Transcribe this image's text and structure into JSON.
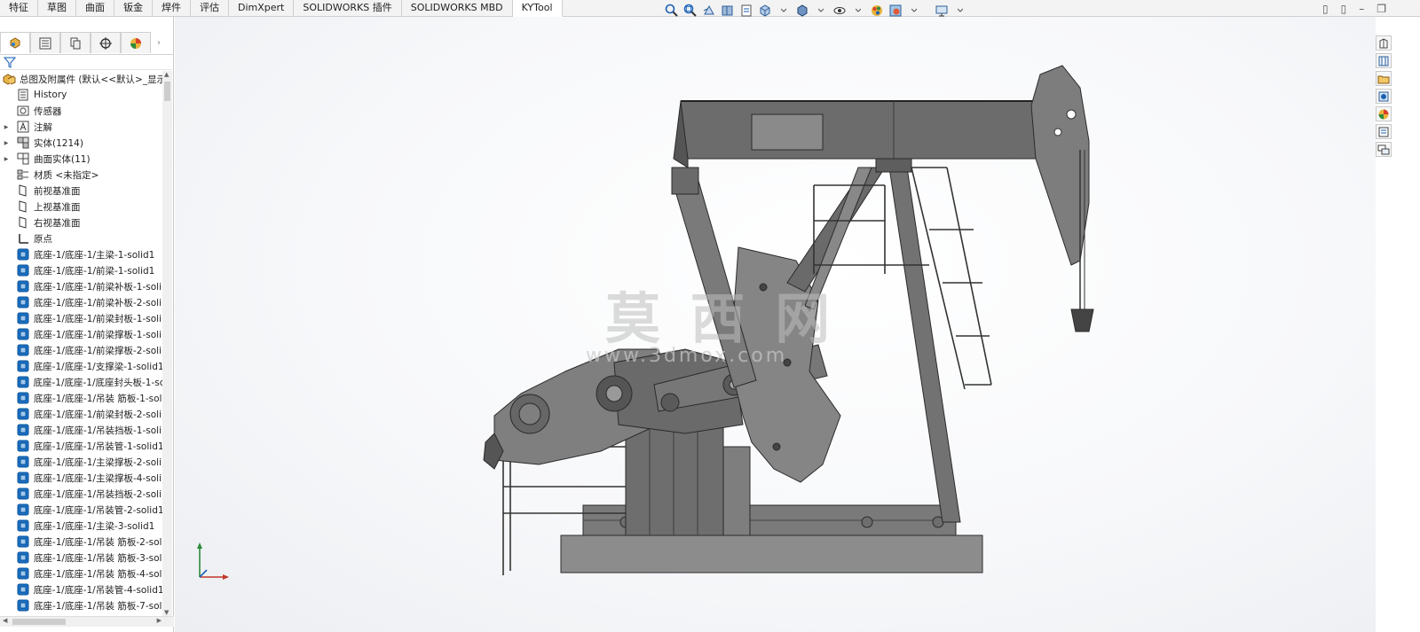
{
  "tabs": [
    {
      "label": "特征",
      "active": false
    },
    {
      "label": "草图",
      "active": false
    },
    {
      "label": "曲面",
      "active": false
    },
    {
      "label": "钣金",
      "active": false
    },
    {
      "label": "焊件",
      "active": false
    },
    {
      "label": "评估",
      "active": false
    },
    {
      "label": "DimXpert",
      "active": false
    },
    {
      "label": "SOLIDWORKS 插件",
      "active": false
    },
    {
      "label": "SOLIDWORKS MBD",
      "active": false
    },
    {
      "label": "KYTool",
      "active": true
    }
  ],
  "hud_icons": [
    "zoom-to-fit-icon",
    "zoom-area-icon",
    "previous-view-icon",
    "section-view-icon",
    "dynamic-annotation-icon",
    "view-orientation-icon",
    "display-style-icon",
    "hide-show-icon",
    "edit-appearance-icon",
    "apply-scene-icon",
    "view-settings-icon"
  ],
  "panel_tabs": [
    "featuremanager-icon",
    "propertymanager-icon",
    "configurationmanager-icon",
    "dimxpert-icon",
    "display-manager-icon"
  ],
  "tree": {
    "root_label": "总图及附属件 (默认<<默认>_显示状",
    "items": [
      {
        "label": "History",
        "icon": "history",
        "expandable": false
      },
      {
        "label": "传感器",
        "icon": "sensor",
        "expandable": false
      },
      {
        "label": "注解",
        "icon": "annotation",
        "expandable": true
      },
      {
        "label": "实体(1214)",
        "icon": "solid-bodies",
        "expandable": true
      },
      {
        "label": "曲面实体(11)",
        "icon": "surface-bodies",
        "expandable": true
      },
      {
        "label": "材质 <未指定>",
        "icon": "material",
        "expandable": false
      },
      {
        "label": "前视基准面",
        "icon": "plane",
        "expandable": false
      },
      {
        "label": "上视基准面",
        "icon": "plane",
        "expandable": false
      },
      {
        "label": "右视基准面",
        "icon": "plane",
        "expandable": false
      },
      {
        "label": "原点",
        "icon": "origin",
        "expandable": false
      },
      {
        "label": "底座-1/底座-1/主梁-1-solid1",
        "icon": "body",
        "expandable": false
      },
      {
        "label": "底座-1/底座-1/前梁-1-solid1",
        "icon": "body",
        "expandable": false
      },
      {
        "label": "底座-1/底座-1/前梁补板-1-soli",
        "icon": "body",
        "expandable": false
      },
      {
        "label": "底座-1/底座-1/前梁补板-2-soli",
        "icon": "body",
        "expandable": false
      },
      {
        "label": "底座-1/底座-1/前梁封板-1-soli",
        "icon": "body",
        "expandable": false
      },
      {
        "label": "底座-1/底座-1/前梁撑板-1-soli",
        "icon": "body",
        "expandable": false
      },
      {
        "label": "底座-1/底座-1/前梁撑板-2-soli",
        "icon": "body",
        "expandable": false
      },
      {
        "label": "底座-1/底座-1/支撑梁-1-solid1",
        "icon": "body",
        "expandable": false
      },
      {
        "label": "底座-1/底座-1/底座封头板-1-sc",
        "icon": "body",
        "expandable": false
      },
      {
        "label": "底座-1/底座-1/吊装 筋板-1-sol",
        "icon": "body",
        "expandable": false
      },
      {
        "label": "底座-1/底座-1/前梁封板-2-soli",
        "icon": "body",
        "expandable": false
      },
      {
        "label": "底座-1/底座-1/吊装挡板-1-soli",
        "icon": "body",
        "expandable": false
      },
      {
        "label": "底座-1/底座-1/吊装管-1-solid1",
        "icon": "body",
        "expandable": false
      },
      {
        "label": "底座-1/底座-1/主梁撑板-2-soli",
        "icon": "body",
        "expandable": false
      },
      {
        "label": "底座-1/底座-1/主梁撑板-4-soli",
        "icon": "body",
        "expandable": false
      },
      {
        "label": "底座-1/底座-1/吊装挡板-2-soli",
        "icon": "body",
        "expandable": false
      },
      {
        "label": "底座-1/底座-1/吊装管-2-solid1",
        "icon": "body",
        "expandable": false
      },
      {
        "label": "底座-1/底座-1/主梁-3-solid1",
        "icon": "body",
        "expandable": false
      },
      {
        "label": "底座-1/底座-1/吊装 筋板-2-sol",
        "icon": "body",
        "expandable": false
      },
      {
        "label": "底座-1/底座-1/吊装 筋板-3-sol",
        "icon": "body",
        "expandable": false
      },
      {
        "label": "底座-1/底座-1/吊装 筋板-4-sol",
        "icon": "body",
        "expandable": false
      },
      {
        "label": "底座-1/底座-1/吊装管-4-solid1",
        "icon": "body",
        "expandable": false
      },
      {
        "label": "底座-1/底座-1/吊装 筋板-7-sol",
        "icon": "body",
        "expandable": false
      }
    ]
  },
  "watermark": {
    "main": "莫 西 网",
    "sub": "www.3dmox.com"
  },
  "taskpane_icons": [
    "solidworks-resources-icon",
    "design-library-icon",
    "file-explorer-icon",
    "view-palette-icon",
    "appearances-icon",
    "custom-properties-icon",
    "forum-icon"
  ],
  "colors": {
    "model_fill": "#7f7f7f",
    "model_dark": "#5e5e5e",
    "model_stroke": "#2b2b2b",
    "accent": "#1a73c8"
  }
}
